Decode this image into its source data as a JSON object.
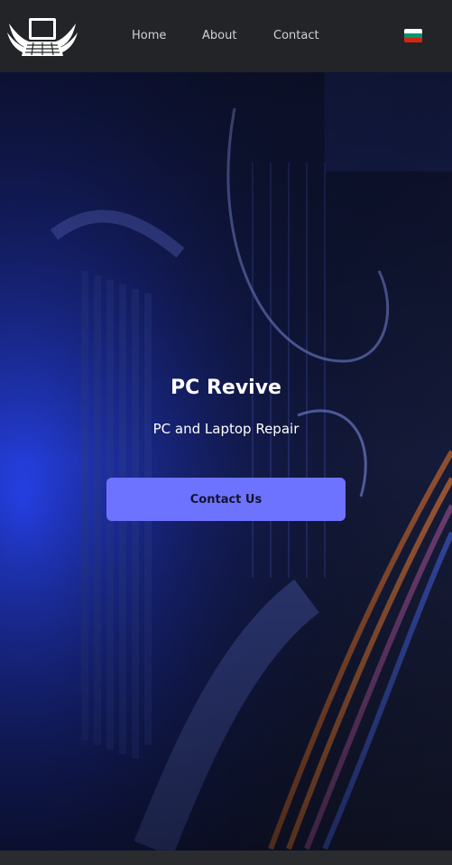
{
  "nav": {
    "logo_icon": "winged-laptop-icon",
    "links": [
      "Home",
      "About",
      "Contact"
    ],
    "language_icon": "bulgarian-flag-icon",
    "flag_colors": [
      "#ffffff",
      "#00966e",
      "#d62612"
    ]
  },
  "hero": {
    "title": "PC Revive",
    "subtitle": "PC and Laptop Repair",
    "button_label": "Contact Us",
    "background": "computer-internals-photo"
  },
  "colors": {
    "navbar": "#232427",
    "accent": "#6e73ff"
  }
}
